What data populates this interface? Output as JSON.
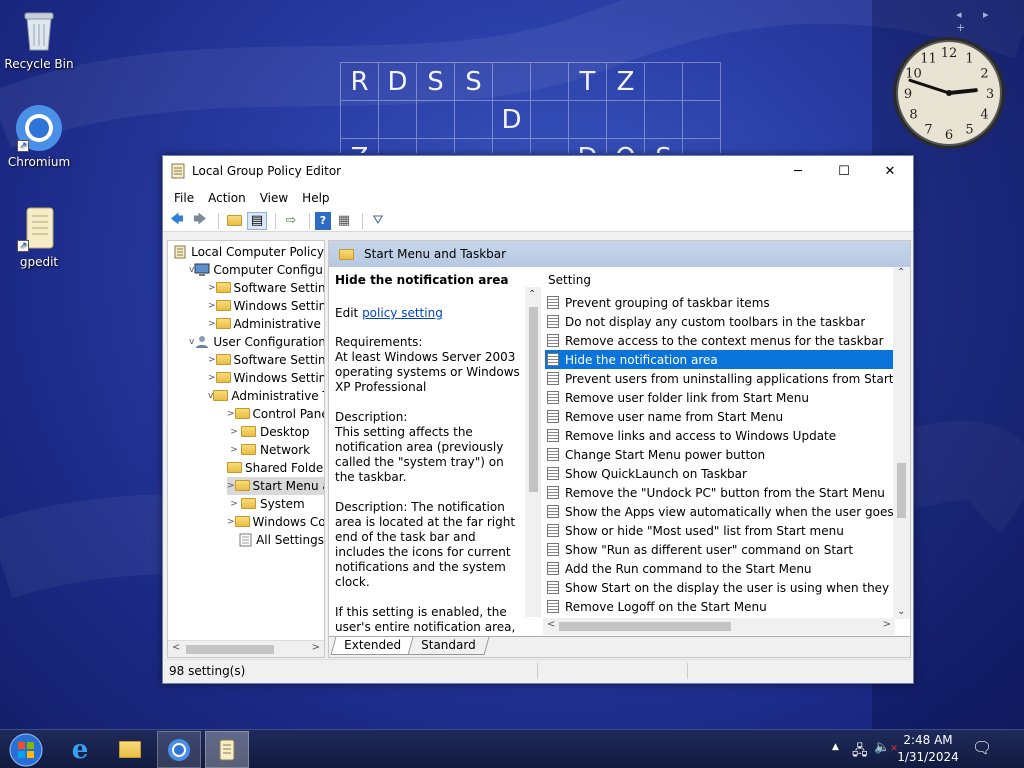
{
  "desktop": {
    "icons": [
      {
        "label": "Recycle Bin",
        "icon": "recycle-bin-icon"
      },
      {
        "label": "Chromium",
        "icon": "chromium-icon"
      },
      {
        "label": "gpedit",
        "icon": "gpedit-icon"
      }
    ],
    "puzzle_letters": {
      "row1": [
        "R",
        "D",
        "S",
        "S",
        "",
        "",
        "T",
        "Z",
        "",
        ""
      ],
      "row2": [
        "",
        "",
        "",
        "",
        "D",
        "",
        "",
        "",
        "",
        ""
      ],
      "row3": [
        "Z",
        "",
        "",
        "",
        "",
        "",
        "D",
        "Q",
        "S",
        ""
      ]
    }
  },
  "clock": {
    "hours": 2,
    "minutes": 48,
    "numbers": [
      "12",
      "1",
      "2",
      "3",
      "4",
      "5",
      "6",
      "7",
      "8",
      "9",
      "10",
      "11"
    ]
  },
  "window": {
    "title": "Local Group Policy Editor",
    "menu": [
      "File",
      "Action",
      "View",
      "Help"
    ],
    "buttons": {
      "minimize": "─",
      "maximize": "☐",
      "close": "✕"
    },
    "tree": {
      "items": [
        {
          "label": "Local Computer Policy",
          "expander": "",
          "level": 0,
          "type": "policy"
        },
        {
          "label": "Computer Configura",
          "expander": "v",
          "level": 1,
          "type": "computer"
        },
        {
          "label": "Software Settings",
          "expander": ">",
          "level": 2,
          "type": "folder"
        },
        {
          "label": "Windows Setting",
          "expander": ">",
          "level": 2,
          "type": "folder"
        },
        {
          "label": "Administrative Te",
          "expander": ">",
          "level": 2,
          "type": "folder"
        },
        {
          "label": "User Configuration",
          "expander": "v",
          "level": 1,
          "type": "user"
        },
        {
          "label": "Software Settings",
          "expander": ">",
          "level": 2,
          "type": "folder"
        },
        {
          "label": "Windows Setting",
          "expander": ">",
          "level": 2,
          "type": "folder"
        },
        {
          "label": "Administrative Te",
          "expander": "v",
          "level": 2,
          "type": "folder"
        },
        {
          "label": "Control Panel",
          "expander": ">",
          "level": 3,
          "type": "folder"
        },
        {
          "label": "Desktop",
          "expander": ">",
          "level": 3,
          "type": "folder"
        },
        {
          "label": "Network",
          "expander": ">",
          "level": 3,
          "type": "folder"
        },
        {
          "label": "Shared Folder",
          "expander": "",
          "level": 3,
          "type": "folder"
        },
        {
          "label": "Start Menu ar",
          "expander": ">",
          "level": 3,
          "type": "folder",
          "selected": true
        },
        {
          "label": "System",
          "expander": ">",
          "level": 3,
          "type": "folder"
        },
        {
          "label": "Windows Cor",
          "expander": ">",
          "level": 3,
          "type": "folder"
        },
        {
          "label": "All Settings",
          "expander": "",
          "level": 3,
          "type": "allsettings"
        }
      ]
    },
    "panel_header": "Start Menu and Taskbar",
    "description": {
      "title": "Hide the notification area",
      "edit_prefix": "Edit ",
      "edit_link": "policy setting",
      "requirements": "Requirements:\nAt least Windows Server 2003 operating systems or Windows XP Professional",
      "desc1": "Description:\nThis setting affects the notification area (previously called the \"system tray\") on the taskbar.",
      "desc2": "Description: The notification area is located at the far right end of the task bar and includes the icons for current notifications and the system clock.",
      "desc3": "If this setting is enabled, the user's entire notification area, including the notification icons, is hidden. The taskbar displays only the Start"
    },
    "list_header": "Setting",
    "settings": [
      "Prevent grouping of taskbar items",
      "Do not display any custom toolbars in the taskbar",
      "Remove access to the context menus for the taskbar",
      "Hide the notification area",
      "Prevent users from uninstalling applications from Start",
      "Remove user folder link from Start Menu",
      "Remove user name from Start Menu",
      "Remove links and access to Windows Update",
      "Change Start Menu power button",
      "Show QuickLaunch on Taskbar",
      "Remove the \"Undock PC\" button from the Start Menu",
      "Show the Apps view automatically when the user goes to St...",
      "Show or hide \"Most used\" list from Start menu",
      "Show \"Run as different user\" command on Start",
      "Add the Run command to the Start Menu",
      "Show Start on the display the user is using when they press t...",
      "Remove Logoff on the Start Menu"
    ],
    "selected_setting_index": 3,
    "tabs": [
      "Extended",
      "Standard"
    ],
    "status": "98 setting(s)"
  },
  "taskbar": {
    "time": "2:48 AM",
    "date": "1/31/2024",
    "apps": [
      "start-orb",
      "internet-explorer",
      "file-explorer",
      "chromium",
      "gpedit"
    ]
  },
  "colors": {
    "selection": "#0a74da",
    "panel_header": "#b6c8e2",
    "taskbar": "#121b3f"
  }
}
